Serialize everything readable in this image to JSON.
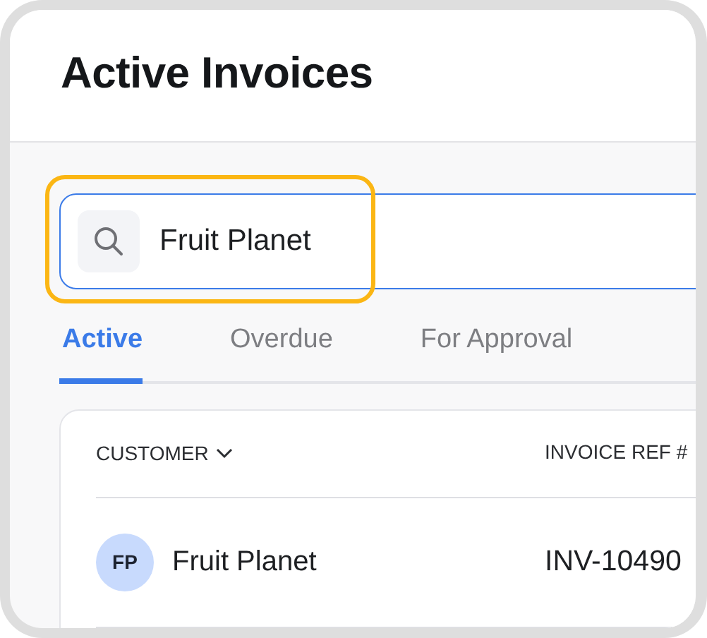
{
  "page": {
    "title": "Active Invoices"
  },
  "search": {
    "value": "Fruit Planet",
    "highlighted": true
  },
  "tabs": [
    {
      "label": "Active",
      "selected": true
    },
    {
      "label": "Overdue",
      "selected": false
    },
    {
      "label": "For Approval",
      "selected": false
    }
  ],
  "table": {
    "columns": [
      {
        "label": "CUSTOMER",
        "sortable": true
      },
      {
        "label": "INVOICE REF #",
        "sortable": false
      }
    ],
    "rows": [
      {
        "initials": "FP",
        "customer": "Fruit Planet",
        "invoice_ref": "INV-10490"
      }
    ]
  }
}
